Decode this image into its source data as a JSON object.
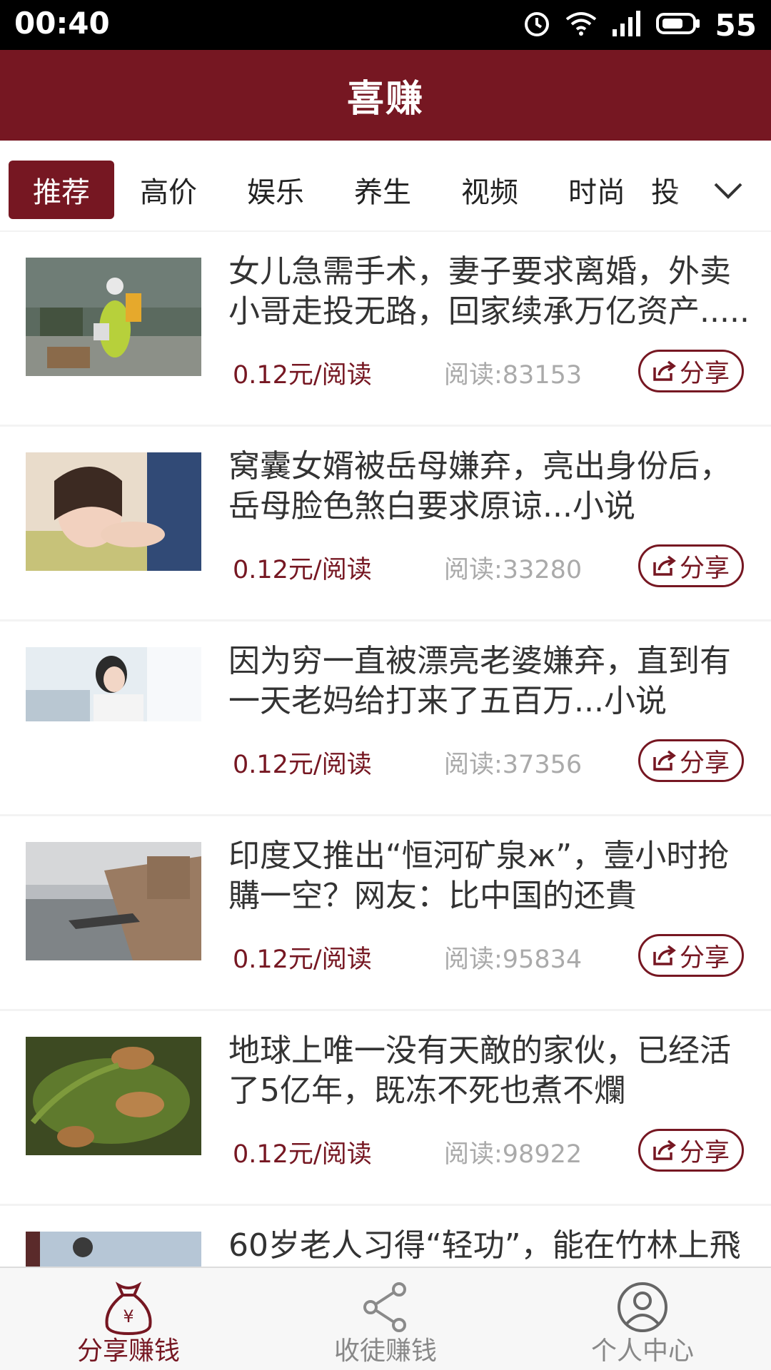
{
  "status_bar": {
    "time": "00:40",
    "battery": "55",
    "icons": [
      "alarm-icon",
      "wifi-icon",
      "signal-icon",
      "battery-icon"
    ]
  },
  "app": {
    "title": "喜赚",
    "accent_color": "#761722"
  },
  "tabs": [
    {
      "label": "推荐",
      "active": true
    },
    {
      "label": "高价"
    },
    {
      "label": "娱乐"
    },
    {
      "label": "养生"
    },
    {
      "label": "视频"
    },
    {
      "label": "时尚"
    },
    {
      "label": "投"
    }
  ],
  "articles": [
    {
      "title": "女儿急需手术，妻子要求离婚，外卖小哥走投无路，回家续承万亿资产.....",
      "price": "0.12元/阅读",
      "reads": "阅读:83153",
      "share": "分享"
    },
    {
      "title": "窝囊女婿被岳母嫌弃，亮出身份后，岳母脸色煞白要求原谅...小说",
      "price": "0.12元/阅读",
      "reads": "阅读:33280",
      "share": "分享"
    },
    {
      "title": "因为穷一直被漂亮老婆嫌弃，直到有一天老妈给打来了五百万...小说",
      "price": "0.12元/阅读",
      "reads": "阅读:37356",
      "share": "分享"
    },
    {
      "title": "印度又推出“恒河矿泉ж”，壹小时抢購一空？网友：比中国的还貴",
      "price": "0.12元/阅读",
      "reads": "阅读:95834",
      "share": "分享"
    },
    {
      "title": "地球上唯一没有天敵的家伙，已经活了5亿年，既冻不死也煮不爛",
      "price": "0.12元/阅读",
      "reads": "阅读:98922",
      "share": "分享"
    },
    {
      "title": "60岁老人习得“轻功”，能在竹林上飛",
      "price": "",
      "reads": "",
      "share": ""
    }
  ],
  "bottom_nav": [
    {
      "label": "分享赚钱",
      "icon": "money-bag-icon",
      "active": true
    },
    {
      "label": "收徒赚钱",
      "icon": "share-network-icon"
    },
    {
      "label": "个人中心",
      "icon": "user-profile-icon"
    }
  ]
}
